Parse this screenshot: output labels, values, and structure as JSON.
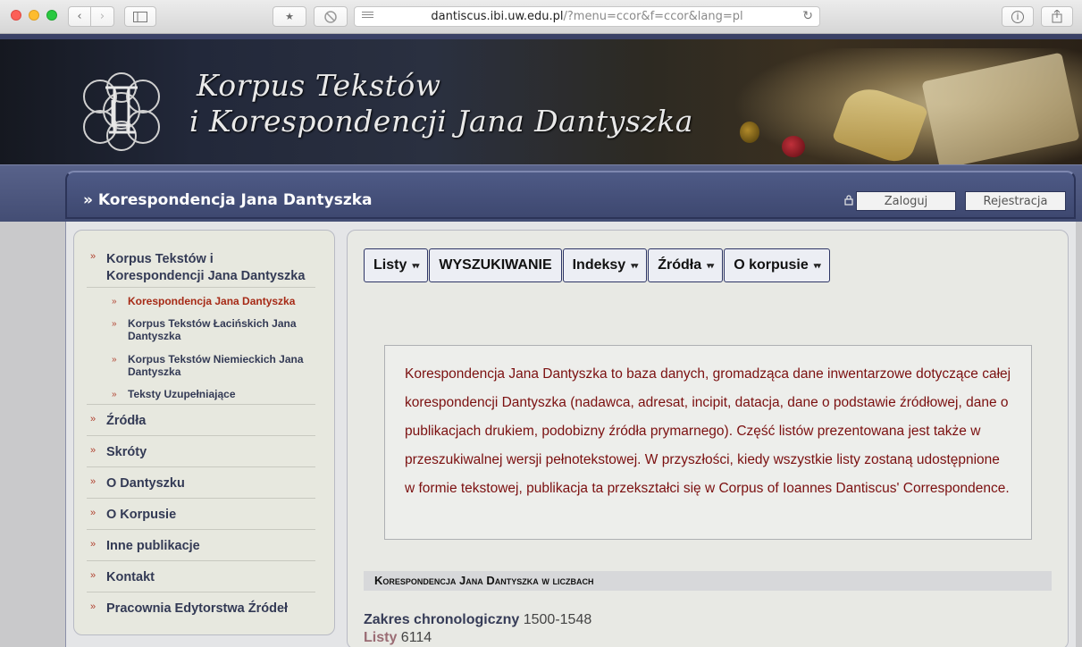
{
  "browser": {
    "url_host": "dantiscus.ibi.uw.edu.pl",
    "url_rest": "/?menu=ccor&f=ccor&lang=pl"
  },
  "banner": {
    "title_line1": "Korpus Tekstów",
    "title_line2": "i Korespondencji Jana Dantyszka"
  },
  "header": {
    "breadcrumb": "» Korespondencja Jana Dantyszka",
    "login_label": "Zaloguj",
    "register_label": "Rejestracja"
  },
  "sidebar": {
    "items": [
      {
        "label_line1": "Korpus Tekstów i",
        "label_line2": "Korespondencji Jana Dantyszka"
      },
      {
        "label": "Źródła"
      },
      {
        "label": "Skróty"
      },
      {
        "label": "O Dantyszku"
      },
      {
        "label": "O Korpusie"
      },
      {
        "label": "Inne publikacje"
      },
      {
        "label": "Kontakt"
      },
      {
        "label": "Pracownia Edytorstwa Źródeł"
      }
    ],
    "subitems": [
      {
        "label": "Korespondencja Jana Dantyszka",
        "active": true
      },
      {
        "label": "Korpus Tekstów Łacińskich Jana Dantyszka"
      },
      {
        "label": "Korpus Tekstów Niemieckich Jana Dantyszka"
      },
      {
        "label": "Teksty Uzupełniające"
      }
    ]
  },
  "menu": {
    "items": [
      {
        "label": "Listy"
      },
      {
        "label": "WYSZUKIWANIE"
      },
      {
        "label": "Indeksy"
      },
      {
        "label": "Źródła"
      },
      {
        "label": "O korpusie"
      }
    ]
  },
  "info": {
    "text": "Korespondencja Jana Dantyszka to baza danych, gromadząca dane inwentarzowe dotyczące całej korespondencji Dantyszka (nadawca, adresat, incipit, datacja, dane o podstawie źródłowej, dane o publikacjach drukiem, podobizny źródła prymarnego). Część listów prezentowana jest także w przeszukiwalnej wersji pełnotekstowej. W przyszłości, kiedy wszystkie listy zostaną udostępnione w formie tekstowej, publikacja ta przekształci się w Corpus of Ioannes Dantiscus' Correspondence."
  },
  "stats": {
    "heading": "Korespondencja Jana Dantyszka w liczbach",
    "range_label": "Zakres chronologiczny",
    "range_value": "1500-1548",
    "letters_label": "Listy",
    "letters_value": "6114"
  }
}
